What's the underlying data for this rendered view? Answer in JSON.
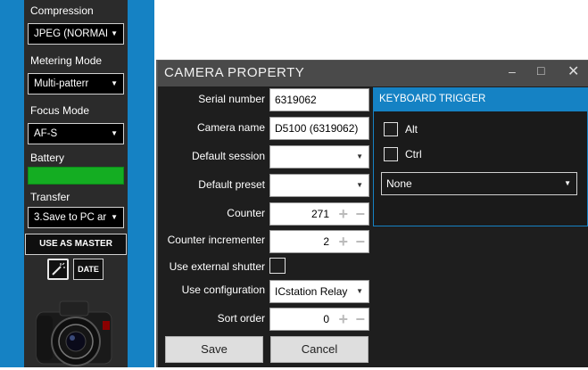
{
  "sidebar": {
    "compression_label": "Compression",
    "compression_value": "JPEG (NORMAI",
    "metering_label": "Metering Mode",
    "metering_value": "Multi-patterr",
    "focus_label": "Focus Mode",
    "focus_value": "AF-S",
    "battery_label": "Battery",
    "battery_level": 1.0,
    "transfer_label": "Transfer",
    "transfer_value": "3.Save to PC ar",
    "use_as_master": "USE AS MASTER",
    "date_button": "DATE",
    "colors": {
      "panel_bg": "#2b2b2b",
      "accent": "#1582c4",
      "battery": "#14ad22"
    }
  },
  "dialog": {
    "title": "CAMERA PROPERTY",
    "serial_label": "Serial number",
    "serial_value": "6319062",
    "camera_name_label": "Camera name",
    "camera_name_value": "D5100 (6319062)",
    "default_session_label": "Default session",
    "default_session_value": "",
    "default_preset_label": "Default preset",
    "default_preset_value": "",
    "counter_label": "Counter",
    "counter_value": "271",
    "counter_inc_label": "Counter incrementer",
    "counter_inc_value": "2",
    "ext_shutter_label": "Use external shutter",
    "use_config_label": "Use configuration",
    "use_config_value": "ICstation  Relay",
    "sort_order_label": "Sort order",
    "sort_order_value": "0",
    "save_button": "Save",
    "cancel_button": "Cancel",
    "keyboard": {
      "header": "KEYBOARD TRIGGER",
      "alt_label": "Alt",
      "ctrl_label": "Ctrl",
      "key_value": "None"
    }
  }
}
